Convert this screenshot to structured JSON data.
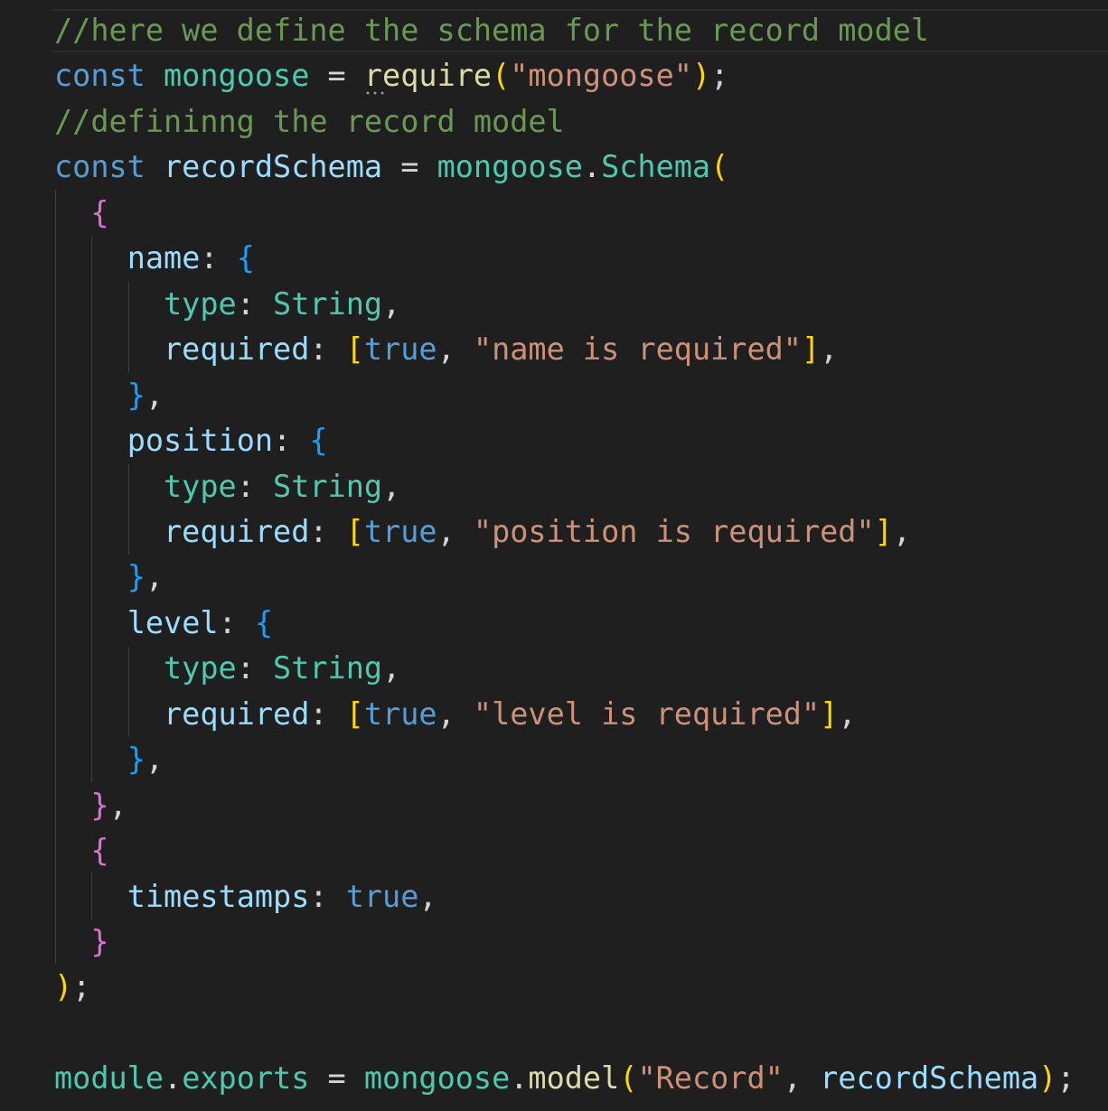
{
  "theme": {
    "background": "#1f1f1f",
    "colors": {
      "comment": "#6a9955",
      "keyword": "#569cd6",
      "constant": "#4ec9b0",
      "function": "#dcdcaa",
      "string": "#ce9178",
      "property": "#9cdcfe",
      "punctuation": "#d4d4d4",
      "bracket_yellow": "#ffd700",
      "bracket_pink": "#da70d6",
      "bracket_blue": "#179fff"
    }
  },
  "code_lines": [
    [
      {
        "text": "//here we define the schema for the record model",
        "color": "#6a9955"
      }
    ],
    [
      {
        "text": "const",
        "color": "#569cd6"
      },
      {
        "text": " ",
        "color": "#d4d4d4"
      },
      {
        "text": "mongoose",
        "color": "#4ec9b0"
      },
      {
        "text": " = ",
        "color": "#d4d4d4"
      },
      {
        "text": "require",
        "color": "#dcdcaa"
      },
      {
        "text": "(",
        "color": "#ffd700"
      },
      {
        "text": "\"mongoose\"",
        "color": "#ce9178"
      },
      {
        "text": ")",
        "color": "#ffd700"
      },
      {
        "text": ";",
        "color": "#d4d4d4"
      }
    ],
    [
      {
        "text": "//defininng the record model",
        "color": "#6a9955"
      }
    ],
    [
      {
        "text": "const",
        "color": "#569cd6"
      },
      {
        "text": " ",
        "color": "#d4d4d4"
      },
      {
        "text": "recordSchema",
        "color": "#9cdcfe"
      },
      {
        "text": " = ",
        "color": "#d4d4d4"
      },
      {
        "text": "mongoose",
        "color": "#4ec9b0"
      },
      {
        "text": ".",
        "color": "#d4d4d4"
      },
      {
        "text": "Schema",
        "color": "#4ec9b0"
      },
      {
        "text": "(",
        "color": "#ffd700"
      }
    ],
    [
      {
        "text": "  ",
        "color": "#d4d4d4"
      },
      {
        "text": "{",
        "color": "#da70d6"
      }
    ],
    [
      {
        "text": "    ",
        "color": "#d4d4d4"
      },
      {
        "text": "name",
        "color": "#9cdcfe"
      },
      {
        "text": ": ",
        "color": "#d4d4d4"
      },
      {
        "text": "{",
        "color": "#179fff"
      }
    ],
    [
      {
        "text": "      ",
        "color": "#d4d4d4"
      },
      {
        "text": "type",
        "color": "#4ec9b0"
      },
      {
        "text": ": ",
        "color": "#d4d4d4"
      },
      {
        "text": "String",
        "color": "#4ec9b0"
      },
      {
        "text": ",",
        "color": "#d4d4d4"
      }
    ],
    [
      {
        "text": "      ",
        "color": "#d4d4d4"
      },
      {
        "text": "required",
        "color": "#9cdcfe"
      },
      {
        "text": ": ",
        "color": "#d4d4d4"
      },
      {
        "text": "[",
        "color": "#ffd700"
      },
      {
        "text": "true",
        "color": "#569cd6"
      },
      {
        "text": ", ",
        "color": "#d4d4d4"
      },
      {
        "text": "\"name is required\"",
        "color": "#ce9178"
      },
      {
        "text": "]",
        "color": "#ffd700"
      },
      {
        "text": ",",
        "color": "#d4d4d4"
      }
    ],
    [
      {
        "text": "    ",
        "color": "#d4d4d4"
      },
      {
        "text": "}",
        "color": "#179fff"
      },
      {
        "text": ",",
        "color": "#d4d4d4"
      }
    ],
    [
      {
        "text": "    ",
        "color": "#d4d4d4"
      },
      {
        "text": "position",
        "color": "#9cdcfe"
      },
      {
        "text": ": ",
        "color": "#d4d4d4"
      },
      {
        "text": "{",
        "color": "#179fff"
      }
    ],
    [
      {
        "text": "      ",
        "color": "#d4d4d4"
      },
      {
        "text": "type",
        "color": "#4ec9b0"
      },
      {
        "text": ": ",
        "color": "#d4d4d4"
      },
      {
        "text": "String",
        "color": "#4ec9b0"
      },
      {
        "text": ",",
        "color": "#d4d4d4"
      }
    ],
    [
      {
        "text": "      ",
        "color": "#d4d4d4"
      },
      {
        "text": "required",
        "color": "#9cdcfe"
      },
      {
        "text": ": ",
        "color": "#d4d4d4"
      },
      {
        "text": "[",
        "color": "#ffd700"
      },
      {
        "text": "true",
        "color": "#569cd6"
      },
      {
        "text": ", ",
        "color": "#d4d4d4"
      },
      {
        "text": "\"position is required\"",
        "color": "#ce9178"
      },
      {
        "text": "]",
        "color": "#ffd700"
      },
      {
        "text": ",",
        "color": "#d4d4d4"
      }
    ],
    [
      {
        "text": "    ",
        "color": "#d4d4d4"
      },
      {
        "text": "}",
        "color": "#179fff"
      },
      {
        "text": ",",
        "color": "#d4d4d4"
      }
    ],
    [
      {
        "text": "    ",
        "color": "#d4d4d4"
      },
      {
        "text": "level",
        "color": "#9cdcfe"
      },
      {
        "text": ": ",
        "color": "#d4d4d4"
      },
      {
        "text": "{",
        "color": "#179fff"
      }
    ],
    [
      {
        "text": "      ",
        "color": "#d4d4d4"
      },
      {
        "text": "type",
        "color": "#4ec9b0"
      },
      {
        "text": ": ",
        "color": "#d4d4d4"
      },
      {
        "text": "String",
        "color": "#4ec9b0"
      },
      {
        "text": ",",
        "color": "#d4d4d4"
      }
    ],
    [
      {
        "text": "      ",
        "color": "#d4d4d4"
      },
      {
        "text": "required",
        "color": "#9cdcfe"
      },
      {
        "text": ": ",
        "color": "#d4d4d4"
      },
      {
        "text": "[",
        "color": "#ffd700"
      },
      {
        "text": "true",
        "color": "#569cd6"
      },
      {
        "text": ", ",
        "color": "#d4d4d4"
      },
      {
        "text": "\"level is required\"",
        "color": "#ce9178"
      },
      {
        "text": "]",
        "color": "#ffd700"
      },
      {
        "text": ",",
        "color": "#d4d4d4"
      }
    ],
    [
      {
        "text": "    ",
        "color": "#d4d4d4"
      },
      {
        "text": "}",
        "color": "#179fff"
      },
      {
        "text": ",",
        "color": "#d4d4d4"
      }
    ],
    [
      {
        "text": "  ",
        "color": "#d4d4d4"
      },
      {
        "text": "}",
        "color": "#da70d6"
      },
      {
        "text": ",",
        "color": "#d4d4d4"
      }
    ],
    [
      {
        "text": "  ",
        "color": "#d4d4d4"
      },
      {
        "text": "{",
        "color": "#da70d6"
      }
    ],
    [
      {
        "text": "    ",
        "color": "#d4d4d4"
      },
      {
        "text": "timestamps",
        "color": "#9cdcfe"
      },
      {
        "text": ": ",
        "color": "#d4d4d4"
      },
      {
        "text": "true",
        "color": "#569cd6"
      },
      {
        "text": ",",
        "color": "#d4d4d4"
      }
    ],
    [
      {
        "text": "  ",
        "color": "#d4d4d4"
      },
      {
        "text": "}",
        "color": "#da70d6"
      }
    ],
    [
      {
        "text": ")",
        "color": "#ffd700"
      },
      {
        "text": ";",
        "color": "#d4d4d4"
      }
    ],
    [],
    [
      {
        "text": "module",
        "color": "#4ec9b0"
      },
      {
        "text": ".",
        "color": "#d4d4d4"
      },
      {
        "text": "exports",
        "color": "#4ec9b0"
      },
      {
        "text": " = ",
        "color": "#d4d4d4"
      },
      {
        "text": "mongoose",
        "color": "#4ec9b0"
      },
      {
        "text": ".",
        "color": "#d4d4d4"
      },
      {
        "text": "model",
        "color": "#dcdcaa"
      },
      {
        "text": "(",
        "color": "#ffd700"
      },
      {
        "text": "\"Record\"",
        "color": "#ce9178"
      },
      {
        "text": ", ",
        "color": "#d4d4d4"
      },
      {
        "text": "recordSchema",
        "color": "#9cdcfe"
      },
      {
        "text": ")",
        "color": "#ffd700"
      },
      {
        "text": ";",
        "color": "#d4d4d4"
      }
    ]
  ]
}
